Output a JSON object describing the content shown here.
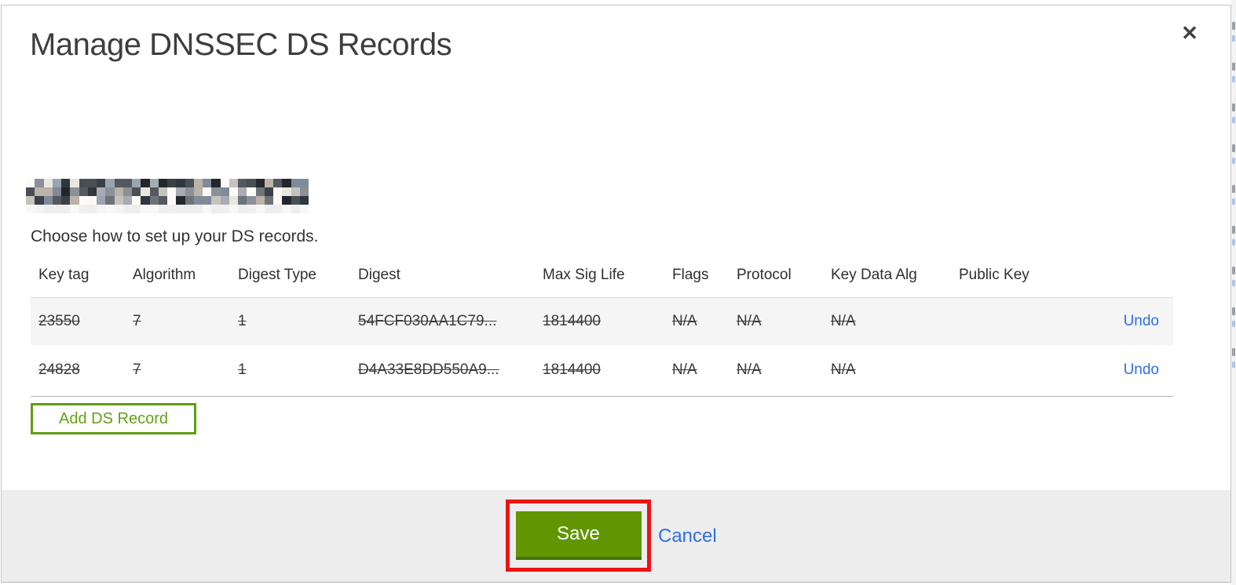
{
  "modal": {
    "title": "Manage DNSSEC DS Records",
    "close_glyph": "✕",
    "instruction": "Choose how to set up your DS records.",
    "domain": {
      "redacted": true
    }
  },
  "table": {
    "columns": [
      "Key tag",
      "Algorithm",
      "Digest Type",
      "Digest",
      "Max Sig Life",
      "Flags",
      "Protocol",
      "Key Data Alg",
      "Public Key"
    ],
    "rows": [
      {
        "key_tag": "23550",
        "algorithm": "7",
        "digest_type": "1",
        "digest": "54FCF030AA1C79...",
        "max_sig_life": "1814400",
        "flags": "N/A",
        "protocol": "N/A",
        "key_data_alg": "N/A",
        "public_key": "",
        "action": "Undo",
        "state": "pending-delete"
      },
      {
        "key_tag": "24828",
        "algorithm": "7",
        "digest_type": "1",
        "digest": "D4A33E8DD550A9...",
        "max_sig_life": "1814400",
        "flags": "N/A",
        "protocol": "N/A",
        "key_data_alg": "N/A",
        "public_key": "",
        "action": "Undo",
        "state": "pending-delete"
      }
    ]
  },
  "actions": {
    "add_record": "Add DS Record",
    "save": "Save",
    "cancel": "Cancel"
  },
  "annotation": {
    "type": "highlight-rectangle",
    "target": "save-button",
    "color": "#ee1212"
  },
  "colors": {
    "green_button_bg": "#619502",
    "green_button_edge": "#48720b",
    "green_outline": "#5f9d13",
    "link_blue": "#2d6fe3",
    "footer_bg": "#ededee",
    "row_alt_bg": "#f5f5f6",
    "modal_border": "#c6c6c6"
  },
  "redacted_mosaic": {
    "cols": 32,
    "rows": 3,
    "palette": [
      "#23262b",
      "#3c4046",
      "#54585f",
      "#6e737b",
      "#8b9099",
      "#a7abb2",
      "#c6c3bd",
      "#e9e6df",
      "#fbfaf6",
      "#303640",
      "#7f8b9b",
      "#b9b3a8",
      "#4a4e55",
      "#9aa5b1"
    ],
    "faint_palette": [
      "#f6f5f3",
      "#efeeec",
      "#f9f8f6",
      "#f1f0ee",
      "#eceff2"
    ]
  }
}
